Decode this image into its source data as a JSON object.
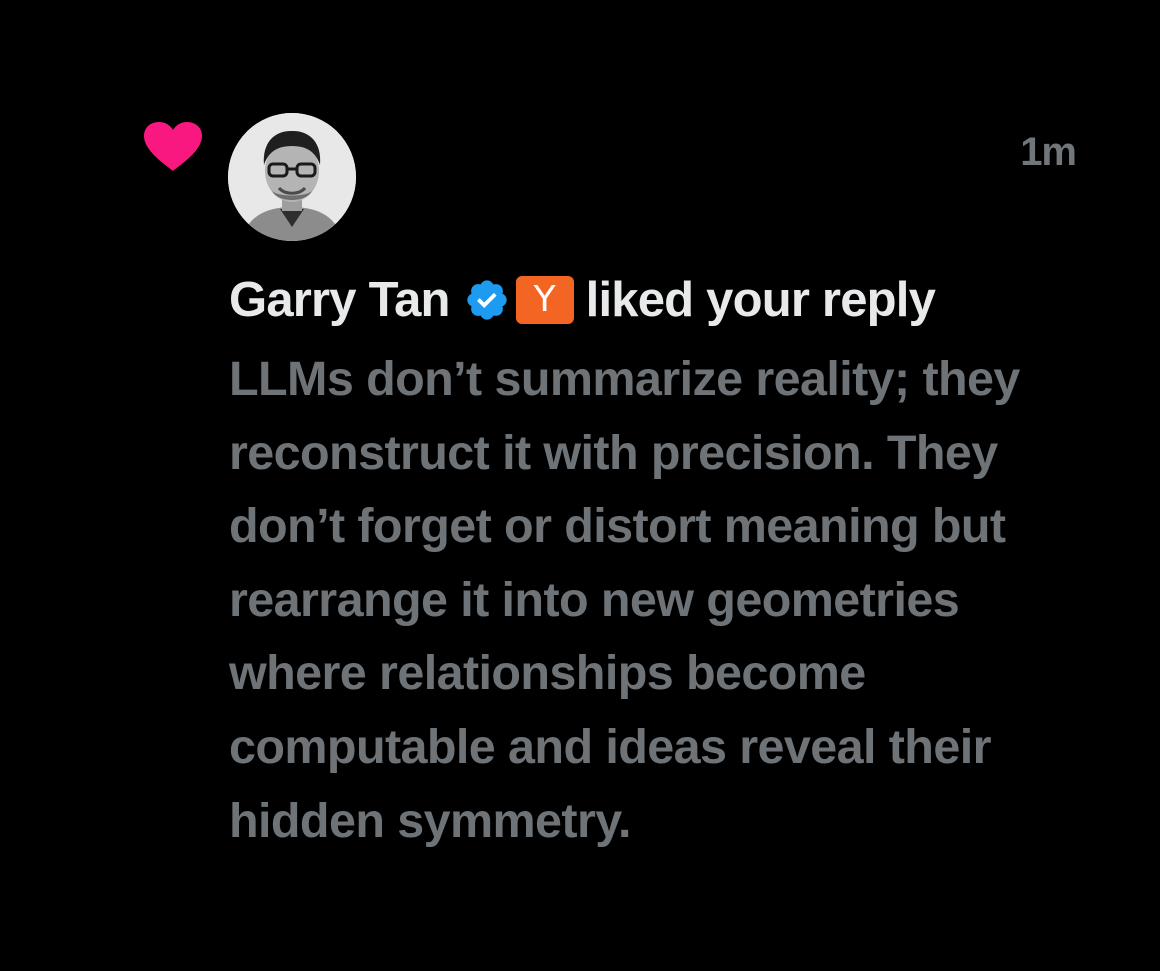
{
  "notification": {
    "type": "like",
    "heart_icon": "heart-icon",
    "heart_color": "#f91880",
    "avatar": "user-avatar",
    "timestamp": "1m",
    "user_name": "Garry Tan",
    "verified_icon": "verified-badge-icon",
    "verified_color": "#1d9bf0",
    "org_badge_letter": "Y",
    "org_badge_color": "#f26522",
    "action_text": "liked your reply",
    "reply_text": "LLMs don’t summarize reality; they reconstruct it with precision. They don’t forget or distort meaning but rearrange it into new geometries where relationships become computable and ideas reveal their hidden symmetry."
  }
}
